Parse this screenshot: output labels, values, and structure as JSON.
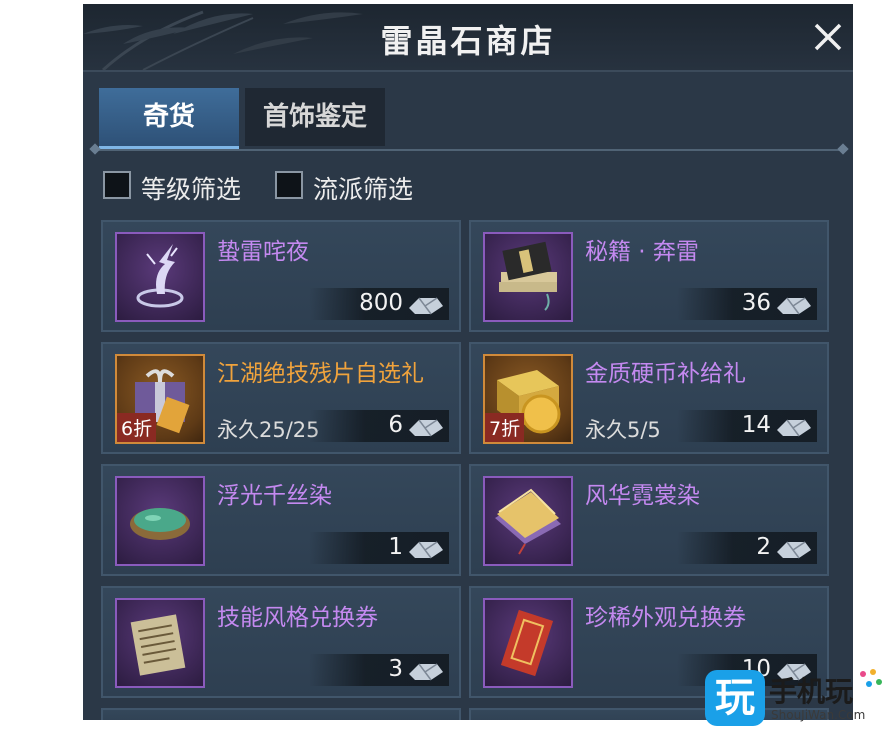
{
  "window": {
    "title": "雷晶石商店",
    "close_icon": "close-icon"
  },
  "tabs": [
    {
      "label": "奇货",
      "active": true
    },
    {
      "label": "首饰鉴定",
      "active": false
    }
  ],
  "filters": [
    {
      "label": "等级筛选",
      "checked": false
    },
    {
      "label": "流派筛选",
      "checked": false
    }
  ],
  "items": [
    {
      "name": "蛰雷咤夜",
      "price": "800",
      "limit": "",
      "discount": "",
      "rarity": "purple",
      "icon": "lightning-icon"
    },
    {
      "name": "秘籍 · 奔雷",
      "price": "36",
      "limit": "",
      "discount": "",
      "rarity": "purple",
      "icon": "book-icon"
    },
    {
      "name": "江湖绝技残片自选礼",
      "price": "6",
      "limit": "永久25/25",
      "discount": "6折",
      "rarity": "orange",
      "icon": "gift-box-icon"
    },
    {
      "name": "金质硬币补给礼",
      "price": "14",
      "limit": "永久5/5",
      "discount": "7折",
      "rarity": "orange",
      "icon": "gold-coin-chest-icon"
    },
    {
      "name": "浮光千丝染",
      "price": "1",
      "limit": "",
      "discount": "",
      "rarity": "purple",
      "icon": "dye-bowl-icon"
    },
    {
      "name": "风华霓裳染",
      "price": "2",
      "limit": "",
      "discount": "",
      "rarity": "purple",
      "icon": "fabric-icon"
    },
    {
      "name": "技能风格兑换券",
      "price": "3",
      "limit": "",
      "discount": "",
      "rarity": "purple",
      "icon": "scroll-icon"
    },
    {
      "name": "珍稀外观兑换券",
      "price": "10",
      "limit": "",
      "discount": "",
      "rarity": "purple",
      "icon": "red-envelope-icon"
    }
  ],
  "currency_icon": "thunder-crystal-icon",
  "watermark": {
    "badge": "玩",
    "text": "手机玩",
    "sub": "ShouJiWan.Com"
  },
  "colors": {
    "panel_bg": "#2b3847",
    "purple_name": "#c489f0",
    "orange_name": "#f0a33c",
    "tab_active": "#3f6d9a",
    "discount_bg": "#8a2a22"
  }
}
